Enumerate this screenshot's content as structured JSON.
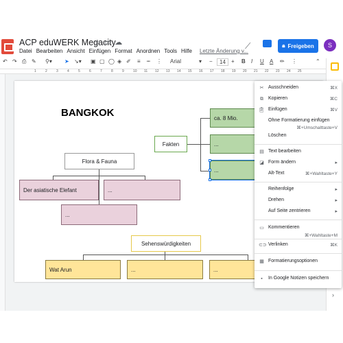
{
  "app": {
    "title": "ACP eduWERK Megacity",
    "menu": [
      "Datei",
      "Bearbeiten",
      "Ansicht",
      "Einfügen",
      "Format",
      "Anordnen",
      "Tools",
      "Hilfe"
    ],
    "last_edit": "Letzte Änderung v...",
    "share_label": "Freigeben",
    "avatar_initial": "S"
  },
  "toolbar": {
    "font": "Arial",
    "font_size": "14",
    "bold": "B",
    "italic": "I",
    "underline": "U",
    "text_color": "A"
  },
  "ruler": {
    "ticks": [
      "1",
      "2",
      "3",
      "4",
      "5",
      "6",
      "7",
      "8",
      "9",
      "10",
      "11",
      "12",
      "13",
      "14",
      "15",
      "16",
      "17",
      "18",
      "19",
      "20",
      "21",
      "22",
      "23",
      "24",
      "25"
    ]
  },
  "slide": {
    "heading": "BANGKOK",
    "fakten": "Fakten",
    "fakten_1": "ca. 8 Mio.",
    "fakten_2": "...",
    "fakten_3": "...",
    "flora": "Flora & Fauna",
    "flora_1": "Der asiatische Elefant",
    "flora_2": "...",
    "flora_3": "...",
    "sights": "Sehenswürdigkeiten",
    "sights_1": "Wat Arun",
    "sights_2": "...",
    "sights_3": "..."
  },
  "context_menu": {
    "cut": {
      "label": "Ausschneiden",
      "shortcut": "⌘X"
    },
    "copy": {
      "label": "Kopieren",
      "shortcut": "⌘C"
    },
    "paste": {
      "label": "Einfügen",
      "shortcut": "⌘V"
    },
    "paste_plain": {
      "label": "Ohne Formatierung einfügen",
      "shortcut": "⌘+Umschalttaste+V"
    },
    "delete": {
      "label": "Löschen"
    },
    "edit_text": {
      "label": "Text bearbeiten"
    },
    "change_shape": {
      "label": "Form ändern"
    },
    "alt_text": {
      "label": "Alt-Text",
      "shortcut": "⌘+Wahltaste+Y"
    },
    "order": {
      "label": "Reihenfolge"
    },
    "rotate": {
      "label": "Drehen"
    },
    "center": {
      "label": "Auf Seite zentrieren"
    },
    "comment": {
      "label": "Kommentieren",
      "shortcut": "⌘+Wahltaste+M"
    },
    "link": {
      "label": "Verlinken",
      "shortcut": "⌘K"
    },
    "format_options": {
      "label": "Formatierungsoptionen"
    },
    "keep": {
      "label": "In Google Notizen speichern"
    }
  },
  "colors": {
    "accent": "#1a73e8",
    "pink": "#ead1dc",
    "yellow": "#ffe599",
    "green": "#b6d7a8",
    "app_icon": "#e24b3b",
    "avatar": "#7b2fbf"
  }
}
